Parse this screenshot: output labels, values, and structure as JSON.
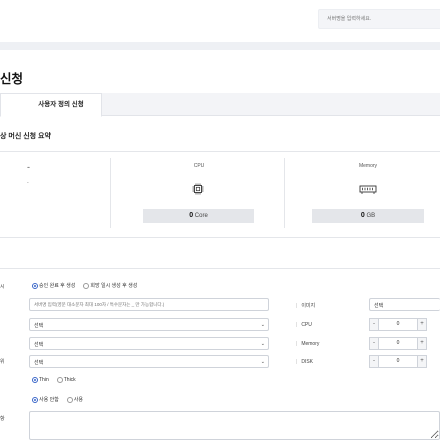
{
  "search": {
    "placeholder": "서버명을 입력하세요."
  },
  "page": {
    "title": "신청"
  },
  "tabs": [
    {
      "label": "사용자 정의 신청"
    }
  ],
  "summary": {
    "title": "상 머신 신청 요약",
    "first": {
      "value": "-",
      "note": "-"
    },
    "cpu": {
      "label": "CPU",
      "value": "0",
      "unit": "Core",
      "icon": "cpu-icon"
    },
    "memory": {
      "label": "Memory",
      "value": "0",
      "unit": "GB",
      "icon": "memory-icon"
    }
  },
  "form": {
    "row1": {
      "label": "시",
      "options": [
        "승인 완료 후 생성",
        "희망 일시 생성 후 생성"
      ],
      "selected": 0
    },
    "name_input": {
      "placeholder": "서버명 입력(영문 대소문자 최대 100자 / 특수문자는 _ 만 가능합니다.)"
    },
    "row3": {
      "select": "선택"
    },
    "row4": {
      "select": "선택"
    },
    "row5": {
      "label": "위",
      "select": "선택"
    },
    "row6": {
      "options": [
        "Thin",
        "Thick"
      ],
      "selected": 0
    },
    "row7": {
      "label": "",
      "options": [
        "사용 안함",
        "사용"
      ],
      "selected": 0
    },
    "row8": {
      "label": "항"
    },
    "image": {
      "label": "이미지",
      "select": "선택"
    },
    "cpu": {
      "label": "CPU",
      "value": "0"
    },
    "memory": {
      "label": "Memory",
      "value": "0"
    },
    "disk": {
      "label": "DISK",
      "value": "0"
    }
  },
  "colors": {
    "accent": "#3a66c8",
    "background": "#eef0f4"
  }
}
